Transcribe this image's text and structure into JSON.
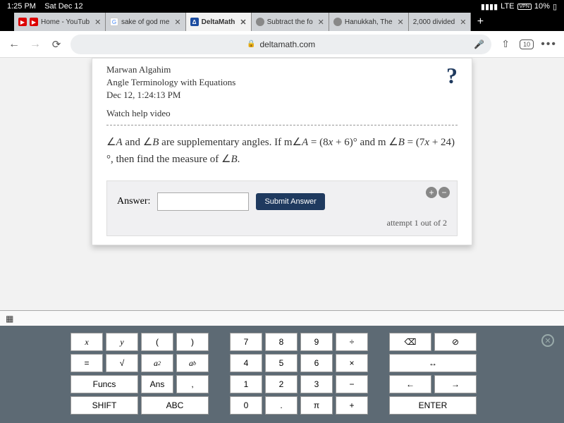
{
  "status": {
    "time": "1:25 PM",
    "date": "Sat Dec 12",
    "network": "LTE",
    "vpn": "VPN",
    "battery": "10%"
  },
  "tabs": [
    {
      "label": "Home - YouTub"
    },
    {
      "label": "sake of god me"
    },
    {
      "label": "DeltaMath"
    },
    {
      "label": "Subtract the fo"
    },
    {
      "label": "Hanukkah, The"
    },
    {
      "label": "2,000 divided"
    }
  ],
  "url": {
    "domain": "deltamath.com",
    "tab_count": "10"
  },
  "card": {
    "student": "Marwan Algahim",
    "topic": "Angle Terminology with Equations",
    "datetime": "Dec 12, 1:24:13 PM",
    "help": "Watch help video",
    "problem_html": "∠<i>A</i> and ∠<i>B</i> are supplementary angles. If m∠<i>A</i> = (8<i>x</i> + 6)° and m ∠<i>B</i> = (7<i>x</i> + 24)°, then find the measure of ∠<i>B</i>.",
    "answer_label": "Answer:",
    "submit": "Submit Answer",
    "attempt": "attempt 1 out of 2"
  },
  "keys": {
    "left": [
      "x",
      "y",
      "(",
      ")",
      "=",
      "√",
      "a²",
      "aᵇ",
      "Funcs",
      "Ans",
      ",",
      "SHIFT",
      "ABC"
    ],
    "mid": [
      "7",
      "8",
      "9",
      "÷",
      "4",
      "5",
      "6",
      "×",
      "1",
      "2",
      "3",
      "−",
      "0",
      ".",
      "π",
      "+"
    ],
    "right": [
      "⌫",
      "⊘",
      "↔",
      "←",
      "→",
      "ENTER"
    ]
  }
}
